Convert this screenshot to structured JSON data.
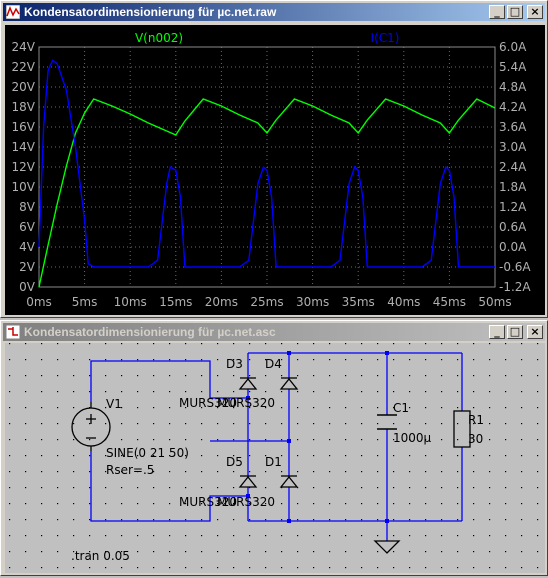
{
  "plot_window": {
    "title": "Kondensatordimensionierung für µc.net.raw",
    "buttons": {
      "minimize": "_",
      "maximize": "□",
      "close": "×"
    }
  },
  "schematic_window": {
    "title": "Kondensatordimensionierung für µc.net.asc",
    "buttons": {
      "minimize": "_",
      "maximize": "□",
      "close": "×"
    }
  },
  "colors": {
    "plot_bg": "#000000",
    "trace_voltage": "#00ff00",
    "trace_current": "#0000ff",
    "axis_text": "#b0b0b0",
    "schematic_bg": "#c0c0c0",
    "wire": "#0000ff",
    "component": "#000000"
  },
  "chart_data": {
    "type": "line",
    "x_unit": "ms",
    "xlim": [
      0,
      50
    ],
    "x_ticks": [
      "0ms",
      "5ms",
      "10ms",
      "15ms",
      "20ms",
      "25ms",
      "30ms",
      "35ms",
      "40ms",
      "45ms",
      "50ms"
    ],
    "y_left": {
      "lim": [
        0,
        24
      ],
      "ticks": [
        "0V",
        "2V",
        "4V",
        "6V",
        "8V",
        "10V",
        "12V",
        "14V",
        "16V",
        "18V",
        "20V",
        "22V",
        "24V"
      ]
    },
    "y_right": {
      "lim": [
        -1.2,
        6.0
      ],
      "ticks": [
        "-1.2A",
        "-0.6A",
        "0.0A",
        "0.6A",
        "1.2A",
        "1.8A",
        "2.4A",
        "3.0A",
        "3.6A",
        "4.2A",
        "4.8A",
        "5.4A",
        "6.0A"
      ]
    },
    "grid": true,
    "series": [
      {
        "name": "V(n002)",
        "axis": "left",
        "x": [
          0,
          1,
          2,
          3,
          4,
          5,
          6,
          8,
          10,
          12,
          14,
          15,
          16,
          18,
          20,
          22,
          24,
          25,
          26,
          28,
          30,
          32,
          34,
          35,
          36,
          38,
          40,
          42,
          44,
          45,
          46,
          48,
          50
        ],
        "y": [
          0,
          4.2,
          8.3,
          12.1,
          15.4,
          17.4,
          18.8,
          18.1,
          17.3,
          16.4,
          15.6,
          15.2,
          16.6,
          18.8,
          18.1,
          17.2,
          16.4,
          15.4,
          16.7,
          18.8,
          18.1,
          17.2,
          16.4,
          15.4,
          16.7,
          18.8,
          18.1,
          17.2,
          16.4,
          15.4,
          16.7,
          18.8,
          17.9
        ]
      },
      {
        "name": "I(C1)",
        "axis": "right",
        "x": [
          0,
          0.5,
          1,
          1.5,
          2,
          3,
          4,
          5,
          5.4,
          6,
          7,
          8,
          10,
          12,
          13,
          14,
          14.4,
          15,
          15.5,
          16,
          20,
          22,
          23,
          24,
          24.6,
          25,
          25.5,
          26,
          30,
          32,
          33,
          34,
          34.6,
          35,
          35.5,
          36,
          40,
          42,
          43,
          44,
          44.6,
          45,
          45.5,
          46,
          48,
          50
        ],
        "y": [
          0,
          3.6,
          5.3,
          5.6,
          5.5,
          4.7,
          3.0,
          0.8,
          -0.5,
          -0.6,
          -0.6,
          -0.6,
          -0.6,
          -0.6,
          -0.4,
          1.9,
          2.4,
          2.3,
          1.5,
          -0.6,
          -0.6,
          -0.6,
          -0.4,
          1.9,
          2.4,
          2.3,
          1.5,
          -0.6,
          -0.6,
          -0.6,
          -0.4,
          1.9,
          2.4,
          2.3,
          1.5,
          -0.6,
          -0.6,
          -0.6,
          -0.4,
          1.9,
          2.4,
          2.3,
          1.5,
          -0.6,
          -0.6,
          -0.6
        ]
      }
    ]
  },
  "schematic": {
    "v1": {
      "name": "V1",
      "value": "SINE(0 21 50)",
      "rser": "Rser=.5"
    },
    "d3": {
      "name": "D3",
      "model": "MURS320"
    },
    "d4": {
      "name": "D4",
      "model": "MURS320"
    },
    "d5": {
      "name": "D5",
      "model": "MURS320"
    },
    "d1": {
      "name": "D1",
      "model": "MURS320"
    },
    "c1": {
      "name": "C1",
      "value": "1000µ"
    },
    "r1": {
      "name": "R1",
      "value": "30"
    },
    "directive": ".tran 0.05"
  }
}
